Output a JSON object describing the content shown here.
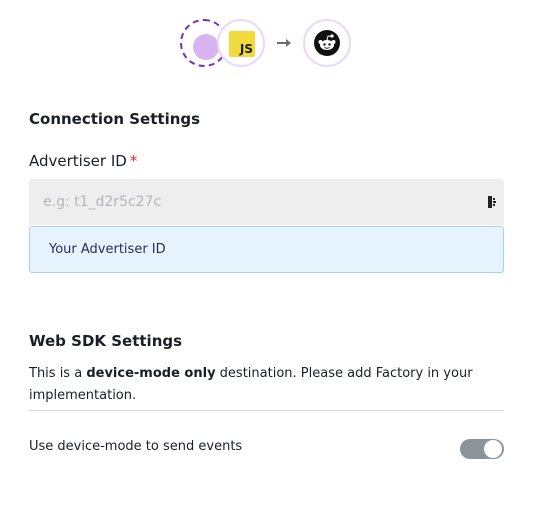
{
  "integration": {
    "source_icon": "purple-dot-icon",
    "library_icon": "javascript-icon",
    "library_badge": "JS",
    "arrow_icon": "arrow-right-icon",
    "destination_icon": "reddit-icon"
  },
  "connection": {
    "title": "Connection Settings",
    "advertiser_label": "Advertiser ID",
    "required_marker": "*",
    "advertiser_placeholder": "e.g: t1_d2r5c27c",
    "advertiser_value": "",
    "paste_icon": "paste-icon",
    "hint": "Your Advertiser ID"
  },
  "sdk": {
    "title": "Web SDK Settings",
    "desc_prefix": "This is a ",
    "desc_bold": "device-mode only",
    "desc_suffix": " destination. Please add Factory in your implementation.",
    "toggle_label": "Use device-mode to send events",
    "toggle_on": true
  },
  "colors": {
    "required": "#d7263d",
    "hint_bg": "#e7f3fc",
    "hint_border": "#a8d2ef",
    "input_bg": "#eeeeee",
    "toggle_bg": "#8d939b",
    "source_dot": "#d8b4f2",
    "source_border": "#7a2fbf",
    "js_yellow": "#f1d93e"
  }
}
